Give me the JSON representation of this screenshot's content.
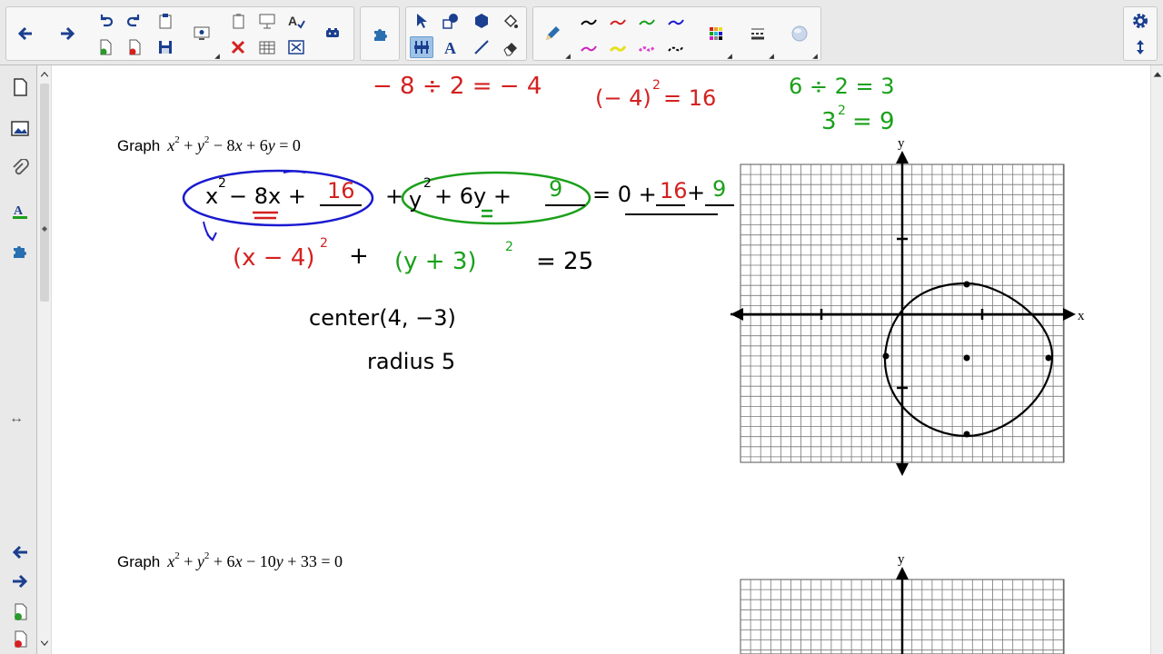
{
  "toolbar": {
    "colors": {
      "red": "#d42020",
      "green": "#1aa01a",
      "blue": "#1a1ad0",
      "magenta": "#d020c0",
      "yellow": "#e6e020",
      "black": "#000000"
    }
  },
  "sidebar": {
    "resize_glyph": "↔"
  },
  "canvas": {
    "problem1": {
      "word": "Graph",
      "eq_parts": [
        "x",
        "2",
        "+ ",
        "y",
        "2",
        "− 8",
        "x",
        " + 6",
        "y",
        " = 0"
      ]
    },
    "problem2": {
      "word": "Graph",
      "eq_parts": [
        "x",
        "2",
        "+ ",
        "y",
        "2",
        "+ 6",
        "x",
        " − 10",
        "y",
        " + 33 = 0"
      ]
    },
    "notes": {
      "red_half": "− 8  ÷ 2  =  − 4",
      "red_square": "(− 4)",
      "red_square_exp": "2",
      "red_square_val": "= 16",
      "green_half": "6 ÷ 2 = 3",
      "green_square": "3",
      "green_square_exp": "2",
      "green_square_val": "= 9",
      "blue_group_x": "x",
      "blue_group_exp": "2",
      "blue_group_rest": " − 8x + ",
      "blue_group_fill": "16",
      "green_group_plus": "+",
      "green_group_y": "y",
      "green_group_exp": "2",
      "green_group_rest": " + 6y + ",
      "green_group_fill": "9",
      "rhs_eq": "= 0 +",
      "rhs_16": "16",
      "rhs_plus": "+",
      "rhs_9": "9",
      "factored_red": "(x − 4)",
      "factored_red_exp": "2",
      "factored_plus": "+",
      "factored_green": "(y + 3)",
      "factored_green_exp": "2",
      "factored_rhs": "= 25",
      "center": "center(4, −3)",
      "radius": "radius  5"
    },
    "graph1": {
      "xlabel": "x",
      "ylabel": "y"
    },
    "graph2": {
      "ylabel": "y"
    }
  }
}
